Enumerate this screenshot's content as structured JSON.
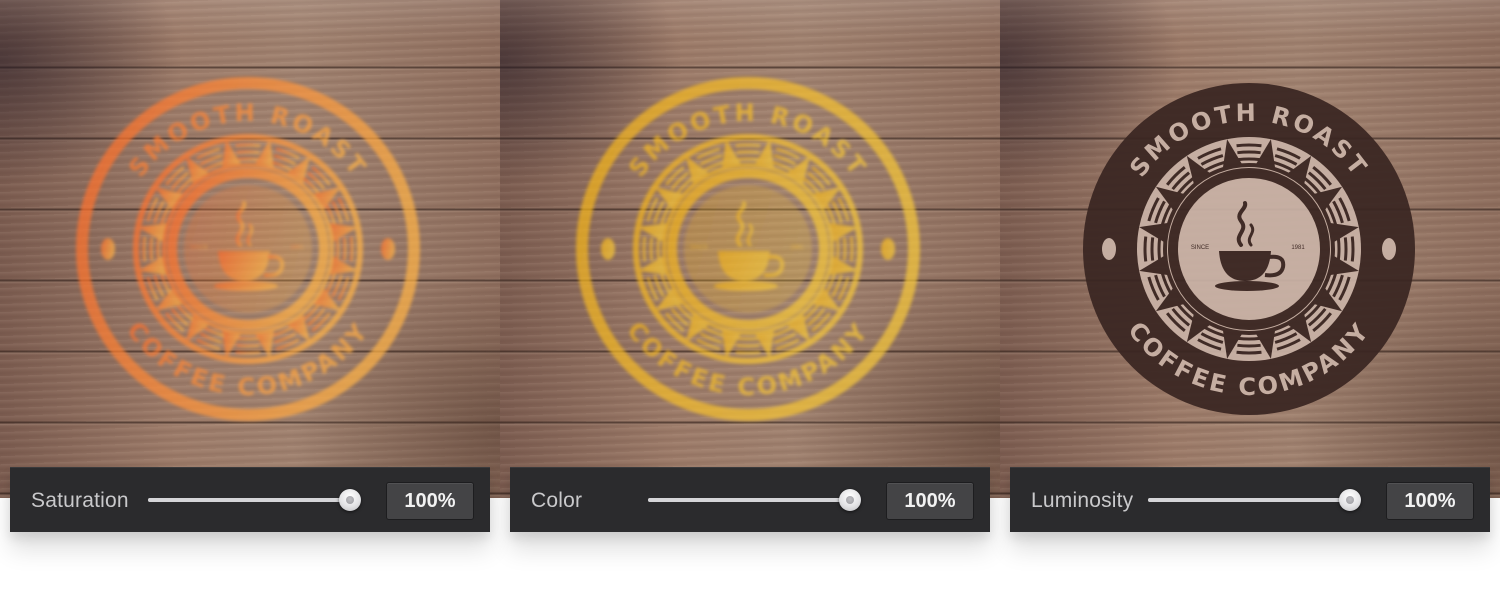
{
  "panels": [
    {
      "label": "Saturation",
      "value": "100%",
      "slider_level": 1.0,
      "logo_style": "saturation",
      "logo_colors": [
        "#ff6a2a",
        "#ffb347"
      ]
    },
    {
      "label": "Color",
      "value": "100%",
      "slider_level": 1.0,
      "logo_style": "color",
      "logo_colors": [
        "#f3b21b",
        "#f7c83a"
      ]
    },
    {
      "label": "Luminosity",
      "value": "100%",
      "slider_level": 1.0,
      "logo_style": "luminosity",
      "logo_colors": [
        "#3a2622",
        "#c9b2a6"
      ]
    }
  ],
  "logo": {
    "top_text": "SMOOTH ROAST",
    "bottom_text": "COFFEE COMPANY",
    "since_label": "SINCE",
    "since_year": "1981"
  }
}
